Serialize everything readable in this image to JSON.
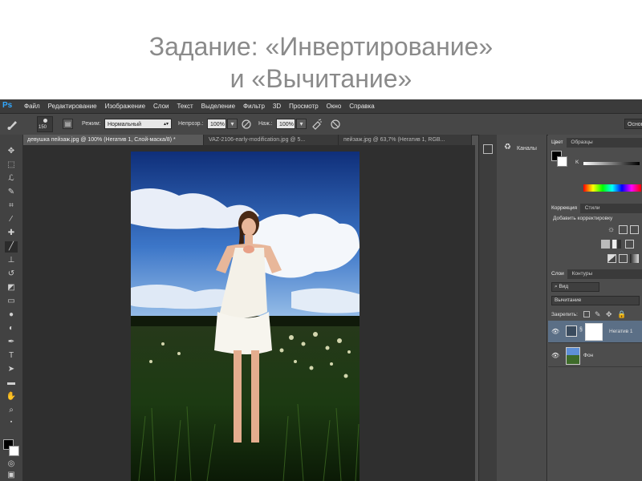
{
  "slide": {
    "title_line1": "Задание: «Инвертирование»",
    "title_line2": "и «Вычитание»"
  },
  "app": {
    "logo": "Ps",
    "menu": [
      "Файл",
      "Редактирование",
      "Изображение",
      "Слои",
      "Текст",
      "Выделение",
      "Фильтр",
      "3D",
      "Просмотр",
      "Окно",
      "Справка"
    ]
  },
  "options": {
    "brush_size": "150",
    "mode_label": "Режим:",
    "mode_value": "Нормальный",
    "opacity_label": "Непрозр.:",
    "opacity_value": "100%",
    "flow_label": "Наж.:",
    "flow_value": "100%",
    "workspace_value": "Основ"
  },
  "tabs": [
    "девушка пейзаж.jpg @ 100% (Негатив 1, Слой-маска/8) *",
    "VAZ-2106-early-modification.jpg @ 5...",
    "пейзаж.jpg @ 63,7% (Негатив 1, RGB..."
  ],
  "channels_panel": {
    "label": "Каналы"
  },
  "color_panel": {
    "tabs": [
      "Цвет",
      "Образцы"
    ],
    "channel_label": "K"
  },
  "correction_panel": {
    "tabs": [
      "Коррекция",
      "Стили"
    ],
    "add_label": "Добавить корректировку"
  },
  "layers_panel": {
    "tabs": [
      "Слои",
      "Контуры"
    ],
    "filter_value": "Вид",
    "blend_value": "Вычитание",
    "lock_label": "Закрепить:",
    "layers": [
      {
        "name": "Негатив 1"
      },
      {
        "name": "Фон"
      }
    ]
  },
  "colors": {
    "ps_blue": "#31a8ff",
    "ui_dark": "#535353",
    "selected_layer": "#5b6f86"
  }
}
